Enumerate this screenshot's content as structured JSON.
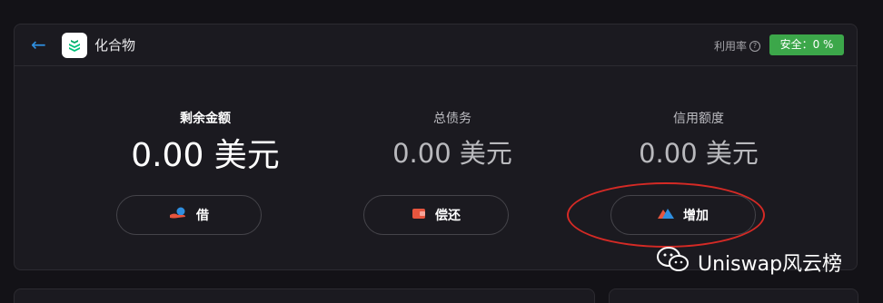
{
  "header": {
    "back_icon": "arrow-left-icon",
    "logo_icon": "compound-logo-icon",
    "title": "化合物",
    "utilization_label": "利用率",
    "help_icon": "help-circle-icon",
    "safety_badge": "安全：0 %"
  },
  "stats": [
    {
      "label": "剩余金额",
      "value": "0.00 美元"
    },
    {
      "label": "总债务",
      "value": "0.00 美元"
    },
    {
      "label": "信用额度",
      "value": "0.00 美元"
    }
  ],
  "actions": [
    {
      "label": "借",
      "icon": "borrow-hand-icon"
    },
    {
      "label": "偿还",
      "icon": "repay-wallet-icon"
    },
    {
      "label": "增加",
      "icon": "mountain-triangle-icon"
    }
  ],
  "watermark": {
    "icon": "wechat-icon",
    "text": "Uniswap风云榜"
  },
  "colors": {
    "background": "#131217",
    "panel": "#1b1a20",
    "accent_blue": "#2f8fe0",
    "safe_green": "#3ca74a",
    "annotation_red": "#d52a25"
  }
}
